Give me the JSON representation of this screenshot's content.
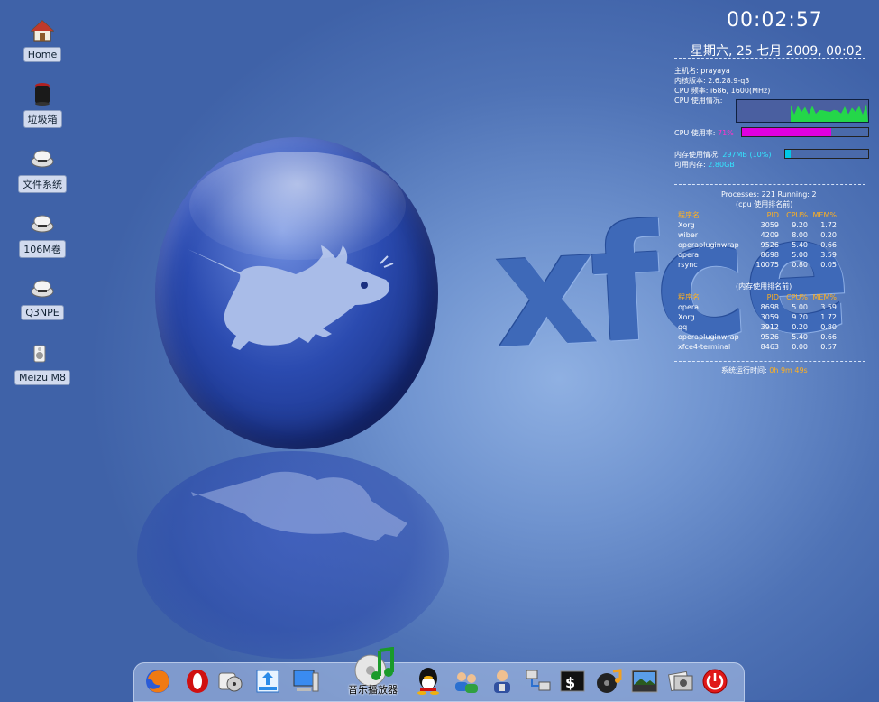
{
  "desktop": {
    "icons": [
      {
        "label": "Home",
        "icon": "home-icon"
      },
      {
        "label": "垃圾箱",
        "icon": "trash-icon"
      },
      {
        "label": "文件系统",
        "icon": "drive-icon"
      },
      {
        "label": "106M卷",
        "icon": "drive-icon"
      },
      {
        "label": "Q3NPE",
        "icon": "drive-icon"
      },
      {
        "label": "Meizu M8",
        "icon": "speaker-icon"
      }
    ],
    "logo_text": "xfce"
  },
  "conky": {
    "clock": "00:02:57",
    "date": "星期六, 25 七月 2009, 00:02",
    "hostname_line": "主机名: prayaya",
    "kernel_line": "内核版本: 2.6.28.9-q3",
    "cpu_freq_line": "CPU 频率: i686, 1600(MHz)",
    "cpu_usage_label": "CPU 使用情况:",
    "cpu_rate_label": "CPU 使用率: ",
    "cpu_rate_value": "71%",
    "cpu_rate_fraction": 0.71,
    "mem_label": "内存使用情况: ",
    "mem_value": "297MB (10%)",
    "mem_fraction": 0.06,
    "mem_free_label": "可用内存: ",
    "mem_free_value": "2.80GB",
    "processes_line": "Processes: 221  Running: 2",
    "cpu_rank_title": "(cpu 使用排名前)",
    "table_headers": [
      "程序名",
      "PID",
      "CPU%",
      "MEM%"
    ],
    "cpu_rows": [
      [
        "Xorg",
        "3059",
        "9.20",
        "1.72"
      ],
      [
        "wiber",
        "4209",
        "8.00",
        "0.20"
      ],
      [
        "operapluginwrap",
        "9526",
        "5.40",
        "0.66"
      ],
      [
        "opera",
        "8698",
        "5.00",
        "3.59"
      ],
      [
        "rsync",
        "10075",
        "0.80",
        "0.05"
      ]
    ],
    "mem_rank_title": "(内存使用排名前)",
    "mem_rows": [
      [
        "opera",
        "8698",
        "5.00",
        "3.59"
      ],
      [
        "Xorg",
        "3059",
        "9.20",
        "1.72"
      ],
      [
        "qq",
        "3912",
        "0.20",
        "0.80"
      ],
      [
        "operapluginwrap",
        "9526",
        "5.40",
        "0.66"
      ],
      [
        "xfce4-terminal",
        "8463",
        "0.00",
        "0.57"
      ]
    ],
    "uptime_label": "系统运行时间: ",
    "uptime_value": "0h 9m 49s",
    "colors": {
      "cpu_bar": "#e000e0",
      "mem_bar": "#00c8e6",
      "graph_line": "#22dd44"
    }
  },
  "dock": {
    "items": [
      {
        "name": "firefox-icon"
      },
      {
        "name": "opera-icon"
      },
      {
        "name": "media-tool-icon"
      },
      {
        "name": "package-icon"
      },
      {
        "name": "computer-icon"
      },
      {
        "name": "music-player-icon"
      },
      {
        "name": "qq-icon"
      },
      {
        "name": "contacts-icon"
      },
      {
        "name": "user-admin-icon"
      },
      {
        "name": "network-icon"
      },
      {
        "name": "terminal-icon"
      },
      {
        "name": "audio-disc-icon"
      },
      {
        "name": "image-viewer-icon"
      },
      {
        "name": "photo-tool-icon"
      },
      {
        "name": "power-icon"
      }
    ],
    "tooltip": "音乐播放器"
  }
}
